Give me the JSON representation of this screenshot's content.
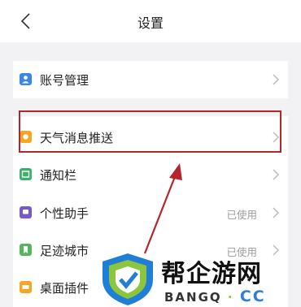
{
  "header": {
    "title": "设置",
    "back_icon": "chevron-left-icon"
  },
  "account": {
    "label": "账号管理",
    "icon_color": "#3a86e8"
  },
  "items": [
    {
      "label": "天气消息推送",
      "status": "",
      "icon_color": "#f5a623"
    },
    {
      "label": "通知栏",
      "status": "",
      "icon_color": "#3ab06a"
    },
    {
      "label": "个性助手",
      "status": "已使用",
      "icon_color": "#7b58c8"
    },
    {
      "label": "足迹城市",
      "status": "已使用",
      "icon_color": "#55b560"
    },
    {
      "label": "桌面插件",
      "status": "",
      "icon_color": "#f5a623"
    }
  ],
  "watermark": {
    "brand": "帮企游网",
    "domain_left": "BANGQ",
    "domain_dot": "·",
    "domain_right": "CC"
  },
  "colors": {
    "highlight": "#b5252c",
    "arrow": "#b5252c",
    "background": "#f2f2f4"
  }
}
